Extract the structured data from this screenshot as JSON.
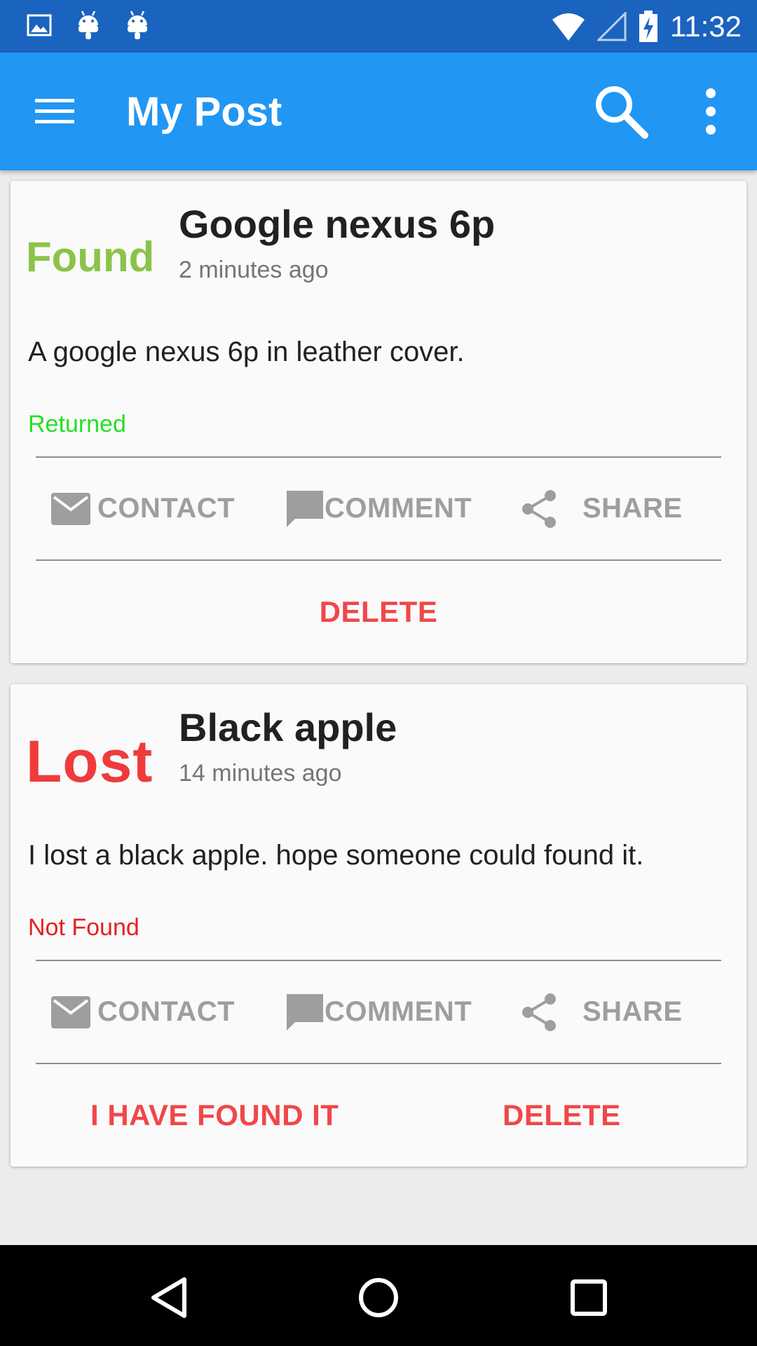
{
  "status_bar": {
    "time": "11:32"
  },
  "app_bar": {
    "title": "My Post"
  },
  "posts": [
    {
      "badge": "Found",
      "title": "Google nexus 6p",
      "time": "2 minutes ago",
      "description": "A google nexus 6p in leather cover.",
      "status": "Returned",
      "actions": {
        "contact": "CONTACT",
        "comment": "COMMENT",
        "share": "SHARE"
      },
      "delete_label": "DELETE"
    },
    {
      "badge": "Lost",
      "title": "Black apple",
      "time": "14 minutes ago",
      "description": "I lost a black apple. hope someone could found it.",
      "status": "Not Found",
      "actions": {
        "contact": "CONTACT",
        "comment": "COMMENT",
        "share": "SHARE"
      },
      "found_label": "I HAVE FOUND IT",
      "delete_label": "DELETE"
    }
  ],
  "colors": {
    "status_bar": "#1a63be",
    "app_bar": "#2196f3",
    "found": "#8bc34a",
    "lost": "#ef3b3b",
    "returned": "#23e023",
    "not_found": "#e52020",
    "action_red": "#f0474a"
  },
  "icons": {
    "status_left": [
      "image-icon",
      "android-icon",
      "android-icon"
    ],
    "status_right": [
      "wifi-icon",
      "signal-icon",
      "battery-charging-icon"
    ],
    "app_bar": [
      "menu-icon",
      "search-icon",
      "more-vert-icon"
    ],
    "actions": [
      "mail-icon",
      "comment-icon",
      "share-icon"
    ],
    "nav": [
      "back-icon",
      "home-icon",
      "recents-icon"
    ]
  }
}
